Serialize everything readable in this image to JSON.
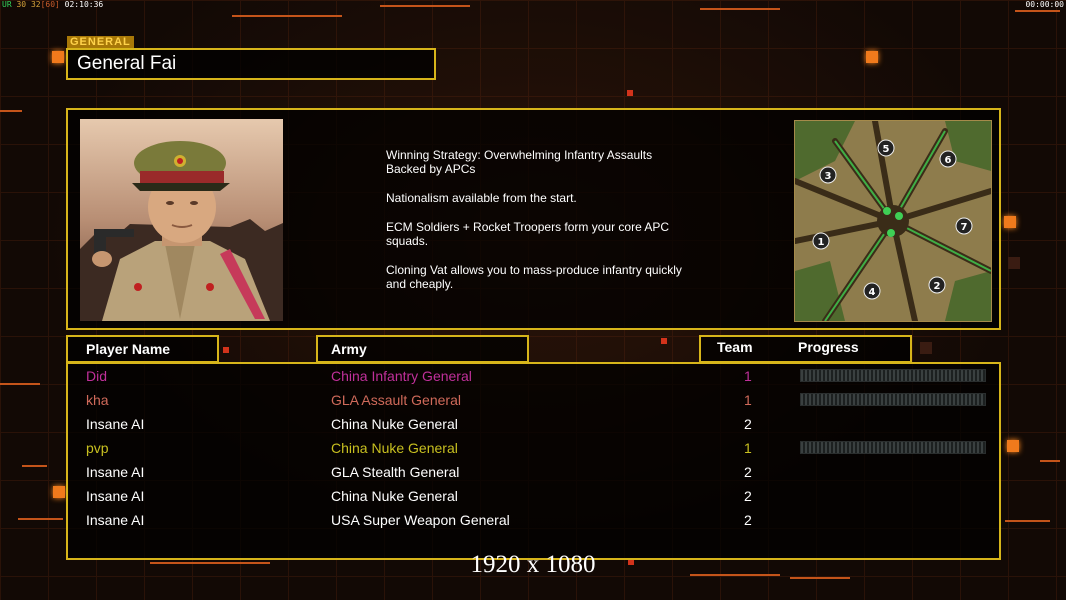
{
  "hud": {
    "top_left": [
      "UR",
      "30",
      "32",
      "[60]",
      "02:10:36"
    ],
    "top_right": "00:00:00"
  },
  "general": {
    "tag": "GENERAL",
    "name": "General Fai",
    "description": [
      "Winning Strategy: Overwhelming Infantry Assaults\n Backed by APCs",
      "Nationalism available from the start.",
      "ECM Soldiers + Rocket Troopers form your core APC\n squads.",
      "Cloning Vat allows you to mass-produce infantry quickly\n and cheaply."
    ]
  },
  "minimap": {
    "start_positions": [
      "1",
      "2",
      "3",
      "4",
      "5",
      "6",
      "7"
    ]
  },
  "table": {
    "headers": {
      "player": "Player Name",
      "army": "Army",
      "team": "Team",
      "progress": "Progress"
    },
    "rows": [
      {
        "player": "Did",
        "army": "China Infantry General",
        "team": "1",
        "color": "#c0309a",
        "progress": 0
      },
      {
        "player": "kha",
        "army": "GLA Assault General",
        "team": "1",
        "color": "#d06a5a",
        "progress": 0
      },
      {
        "player": "Insane AI",
        "army": "China Nuke General",
        "team": "2",
        "color": "#ffffff",
        "progress": null
      },
      {
        "player": "pvp",
        "army": "China Nuke General",
        "team": "1",
        "color": "#c8c020",
        "progress": 0
      },
      {
        "player": "Insane AI",
        "army": "GLA Stealth General",
        "team": "2",
        "color": "#ffffff",
        "progress": null
      },
      {
        "player": "Insane AI",
        "army": "China Nuke General",
        "team": "2",
        "color": "#ffffff",
        "progress": null
      },
      {
        "player": "Insane AI",
        "army": "USA Super Weapon General",
        "team": "2",
        "color": "#ffffff",
        "progress": null
      }
    ]
  },
  "resolution_label": "1920 x 1080",
  "colors": {
    "accent_gold": "#d7b51a",
    "decor_orange": "#f07a1c"
  }
}
